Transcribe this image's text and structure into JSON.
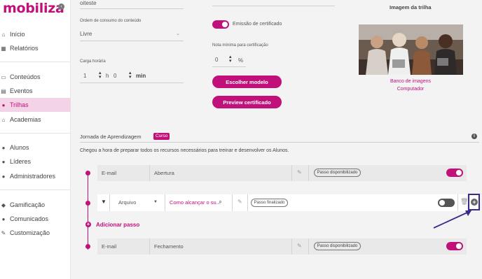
{
  "sidebar": {
    "logo": "mobiliza",
    "items": [
      {
        "label": "Início",
        "icon": "home-icon"
      },
      {
        "label": "Relatórios",
        "icon": "chart-icon"
      },
      {
        "label": "Conteúdos",
        "icon": "file-icon"
      },
      {
        "label": "Eventos",
        "icon": "calendar-icon"
      },
      {
        "label": "Trilhas",
        "icon": "trail-icon",
        "active": true
      },
      {
        "label": "Academias",
        "icon": "academy-icon"
      },
      {
        "label": "Alunos",
        "icon": "user-icon"
      },
      {
        "label": "Líderes",
        "icon": "leaders-icon"
      },
      {
        "label": "Administradores",
        "icon": "admin-icon"
      },
      {
        "label": "Gamificação",
        "icon": "gamepad-icon"
      },
      {
        "label": "Comunicados",
        "icon": "chat-icon"
      },
      {
        "label": "Customização",
        "icon": "brush-icon"
      }
    ]
  },
  "form": {
    "top_value": "oiteste",
    "order_label": "Ordem de consumo do conteúdo",
    "order_value": "Livre",
    "hours_label": "Carga horária",
    "hours_value": "1",
    "hours_unit": "h",
    "minutes_value": "0",
    "minutes_unit": "min",
    "certificate_label": "Emissão de certificado",
    "min_grade_label": "Nota mínima para certificação",
    "min_grade_value": "0",
    "min_grade_unit": "%",
    "choose_model": "Escolher modelo",
    "preview_certificate": "Preview certificado"
  },
  "image_panel": {
    "title": "Imagem da trilha",
    "bank_link": "Banco de imagens",
    "computer_link": "Computador"
  },
  "journey": {
    "title": "Jornada de Aprendizagem",
    "badge": "Curso",
    "description": "Chegou a hora de preparar todos os recursos necessários para treinar e desenvolver os Alunos.",
    "add_step": "Adicionar passo",
    "steps": [
      {
        "type": "E-mail",
        "name": "Abertura",
        "status": "Passo disponibilizado",
        "toggle": "on"
      },
      {
        "type": "Arquivo",
        "name": "Como alcançar o su...",
        "status": "Passo finalizado",
        "toggle": "off"
      },
      {
        "type": "E-mail",
        "name": "Fechamento",
        "status": "Passo disponibilizado",
        "toggle": "on"
      }
    ]
  },
  "colors": {
    "accent": "#c2107b",
    "highlight_box": "#3a2a8c"
  }
}
